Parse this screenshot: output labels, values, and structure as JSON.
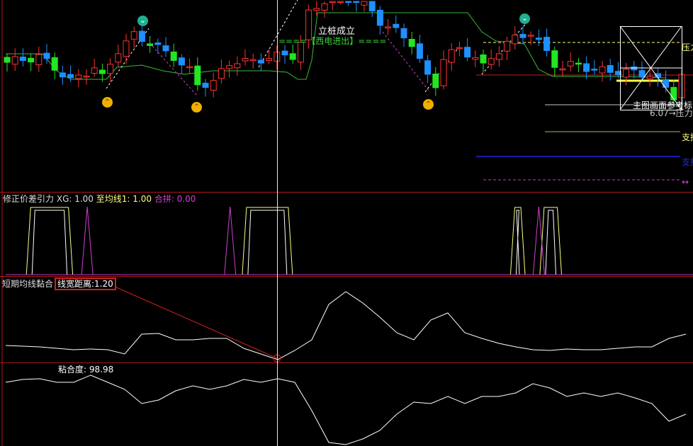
{
  "colors": {
    "up": "#ff3232",
    "down_blue": "#1e90ff",
    "down_green": "#22e622",
    "ma": "#3cb83c",
    "panel_border": "#b01818",
    "crosshair": "#e8e8e8",
    "magenta": "#d040d0",
    "yellow": "#ffff80"
  },
  "main": {
    "annotation_pile": "立桩成立",
    "annotation_signal": "====【西电进出】====",
    "ref_label": "主图画面参考标",
    "ref_value": "6.07",
    "ref_arrow": "→压力",
    "right_labels": {
      "pressure": "压力",
      "support1": "支撑",
      "support2": "支撑",
      "dash": "↔"
    },
    "icons": [
      "chevron-down-icon",
      "chevron-up-icon"
    ],
    "close_keypoints": [
      [
        0,
        21.2
      ],
      [
        4,
        22.0
      ],
      [
        6,
        20.5
      ],
      [
        8,
        18.5
      ],
      [
        11,
        20.5
      ],
      [
        12,
        19.0
      ],
      [
        14,
        23.0
      ],
      [
        16,
        25.0
      ],
      [
        18,
        24.0
      ],
      [
        20,
        22.5
      ],
      [
        21,
        22.0
      ],
      [
        23,
        20.0
      ],
      [
        24,
        18.0
      ],
      [
        26,
        18.5
      ],
      [
        28,
        21.0
      ],
      [
        29,
        21.5
      ],
      [
        31,
        21.2
      ],
      [
        33,
        22.0
      ],
      [
        36,
        22.2
      ],
      [
        37,
        24.0
      ],
      [
        38,
        28.0
      ],
      [
        40,
        30.0
      ],
      [
        43,
        30.5
      ],
      [
        45,
        29.5
      ],
      [
        47,
        27.0
      ],
      [
        49,
        25.5
      ],
      [
        51,
        24.0
      ],
      [
        53,
        19.0
      ],
      [
        54,
        18.0
      ],
      [
        55,
        22.0
      ],
      [
        57,
        23.0
      ],
      [
        59,
        22.0
      ],
      [
        60,
        20.5
      ],
      [
        62,
        23.0
      ],
      [
        63,
        24.0
      ],
      [
        66,
        25.5
      ],
      [
        67,
        24.0
      ],
      [
        69,
        21.0
      ],
      [
        70,
        20.5
      ],
      [
        72,
        21.0
      ],
      [
        74,
        20.0
      ],
      [
        77,
        20.0
      ],
      [
        79,
        19.7
      ],
      [
        81,
        19.5
      ],
      [
        83,
        17.5
      ],
      [
        84,
        16.5
      ],
      [
        85,
        19.5
      ]
    ]
  },
  "indicator1": {
    "title": "修正价差引力",
    "xg_label": "XG: 1.00",
    "avg_label": "至均线1: 1.00",
    "merge_label": "合拼: 0.00",
    "signals": [
      {
        "start": 2.7,
        "end": 8.0,
        "kind": "plateau"
      },
      {
        "start": 29.9,
        "end": 35.7,
        "kind": "plateau"
      },
      {
        "start": 63.7,
        "end": 65.0,
        "kind": "plateau"
      },
      {
        "start": 67.4,
        "end": 69.6,
        "kind": "plateau"
      },
      {
        "center": 10.1,
        "kind": "spike"
      },
      {
        "center": 28.1,
        "kind": "spike"
      },
      {
        "center": 67.0,
        "kind": "spike"
      }
    ]
  },
  "indicator2": {
    "title": "短期均线黏合",
    "width_label": "线宽距离:",
    "width_value": "1.20",
    "values": [
      2.4,
      2.3,
      2.2,
      2.0,
      1.8,
      1.9,
      1.8,
      1.2,
      4.0,
      4.1,
      3.2,
      3.2,
      3.4,
      3.4,
      2.0,
      1.2,
      0.4,
      1.7,
      3.2,
      8.2,
      10.0,
      8.4,
      6.4,
      4.2,
      3.2,
      6.0,
      7.0,
      4.2,
      3.4,
      2.7,
      2.2,
      1.8,
      1.7,
      1.9,
      1.8,
      1.8,
      2.0,
      2.2,
      2.2,
      3.4,
      4.0
    ]
  },
  "indicator3": {
    "title": "粘合度: 98.98",
    "values": [
      9.0,
      9.4,
      9.5,
      9.0,
      9.0,
      10.0,
      9.0,
      8.0,
      6.0,
      6.5,
      7.8,
      8.5,
      8.0,
      8.5,
      9.4,
      9.0,
      9.5,
      9.0,
      5.0,
      0.5,
      0.2,
      1.0,
      2.2,
      4.5,
      6.2,
      6.0,
      7.0,
      6.0,
      7.0,
      7.0,
      7.5,
      8.8,
      8.2,
      7.0,
      7.5,
      7.0,
      7.5,
      6.8,
      6.0,
      3.5,
      4.5
    ]
  }
}
